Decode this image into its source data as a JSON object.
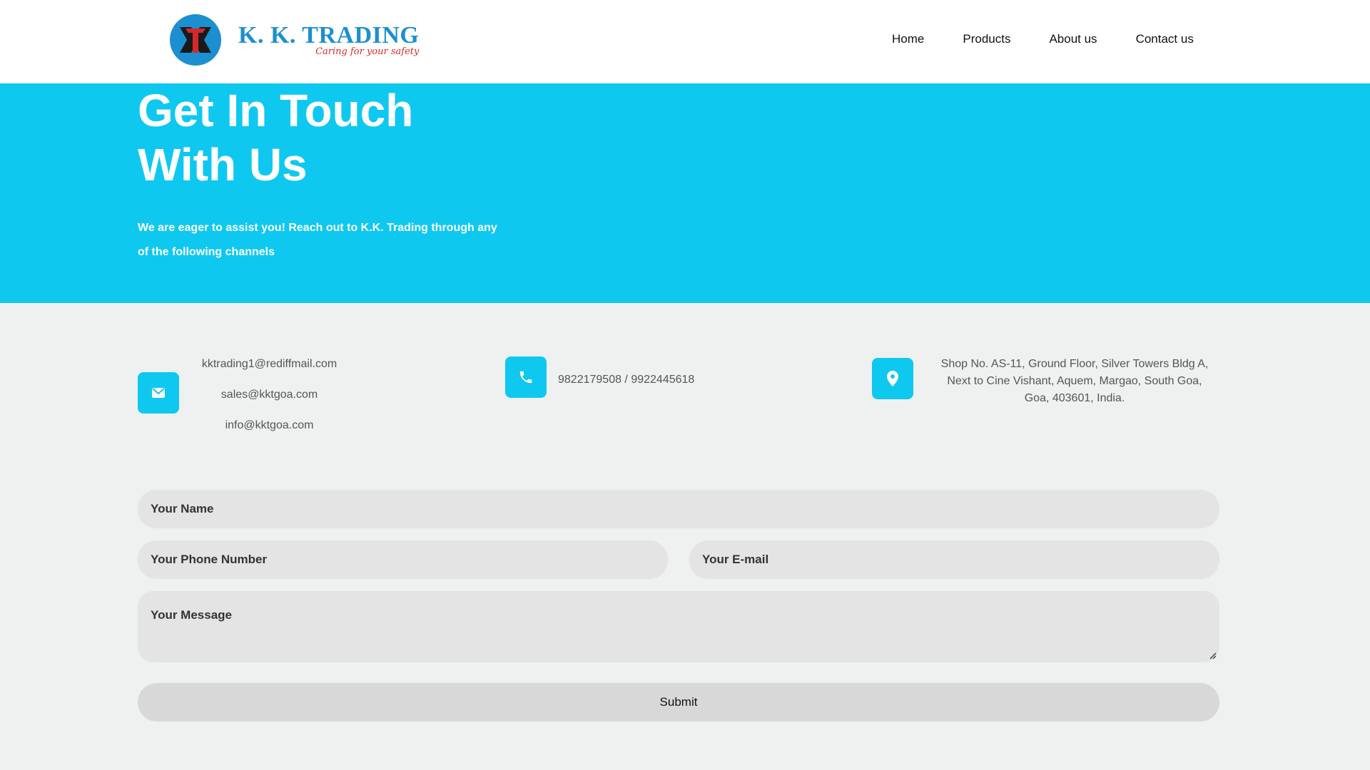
{
  "brand": {
    "name": "K. K. TRADING",
    "tagline": "Caring for your safety",
    "primary_color": "#1c8fd0",
    "accent_color": "#d6282a"
  },
  "nav": {
    "items": [
      {
        "label": "Home"
      },
      {
        "label": "Products"
      },
      {
        "label": "About us"
      },
      {
        "label": "Contact us"
      }
    ]
  },
  "hero": {
    "title_line1": "Get In Touch",
    "title_line2": "With Us",
    "subtitle_line1": "We are eager to assist you! Reach out to K.K. Trading through any",
    "subtitle_line2": "of the following channels",
    "background": "#0fc8ef"
  },
  "contacts": {
    "email": {
      "icon": "mail-icon",
      "addresses": [
        "kktrading1@rediffmail.com",
        "sales@kktgoa.com",
        "info@kktgoa.com"
      ]
    },
    "phone": {
      "icon": "phone-icon",
      "numbers": "9822179508 / 9922445618"
    },
    "address": {
      "icon": "location-pin-icon",
      "line1": "Shop No. AS-11, Ground Floor, Silver Towers Bldg A,",
      "line2": "Next to Cine Vishant, Aquem, Margao, South Goa,",
      "line3": "Goa, 403601, India."
    }
  },
  "form": {
    "name_placeholder": "Your Name",
    "phone_placeholder": "Your Phone Number",
    "email_placeholder": "Your E-mail",
    "message_placeholder": "Your Message",
    "submit_label": "Submit"
  }
}
